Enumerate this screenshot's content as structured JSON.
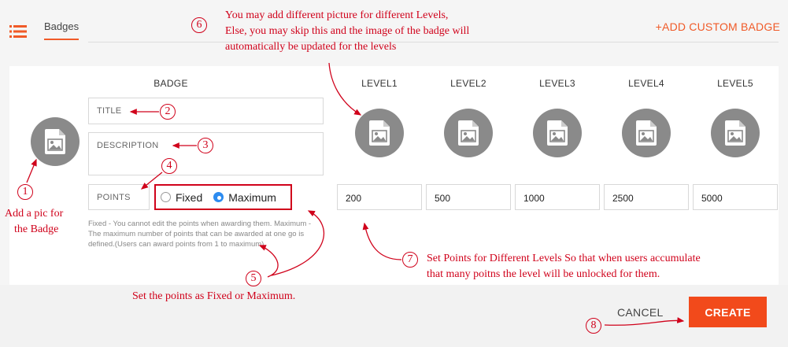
{
  "header": {
    "tab_label": "Badges",
    "add_custom_label": "+ADD CUSTOM BADGE"
  },
  "form": {
    "badge_heading": "BADGE",
    "title_placeholder": "TITLE",
    "description_placeholder": "DESCRIPTION",
    "points_label": "POINTS",
    "radio_fixed": "Fixed",
    "radio_maximum": "Maximum",
    "radio_selected": "Maximum",
    "help_text": "Fixed - You cannot edit the points when awarding them. Maximum - The maximum number of points that can be awarded at one go is defined.(Users can award points from 1 to maximum)"
  },
  "levels": [
    {
      "label": "LEVEL1",
      "points": "200"
    },
    {
      "label": "LEVEL2",
      "points": "500"
    },
    {
      "label": "LEVEL3",
      "points": "1000"
    },
    {
      "label": "LEVEL4",
      "points": "2500"
    },
    {
      "label": "LEVEL5",
      "points": "5000"
    }
  ],
  "footer": {
    "cancel_label": "CANCEL",
    "create_label": "CREATE"
  },
  "annotations": {
    "n1": "1",
    "n2": "2",
    "n3": "3",
    "n4": "4",
    "n5": "5",
    "n6": "6",
    "n7": "7",
    "n8": "8",
    "a1_line1": "Add a pic for",
    "a1_line2": "the Badge",
    "a5": "Set the points as Fixed or Maximum.",
    "a6_line1": "You may add different picture for different Levels,",
    "a6_line2": "Else, you may skip this and the image of the badge will",
    "a6_line3": "automatically be updated for the levels",
    "a7_line1": "Set Points for Different Levels So that when users accumulate",
    "a7_line2": "that many poitns the level will be unlocked for them."
  },
  "colors": {
    "accent": "#f05a28",
    "create_button": "#f24a1b",
    "annotation_red": "#d0021b",
    "radio_selected": "#2d8cf0",
    "avatar_grey": "#8a8a8a"
  }
}
